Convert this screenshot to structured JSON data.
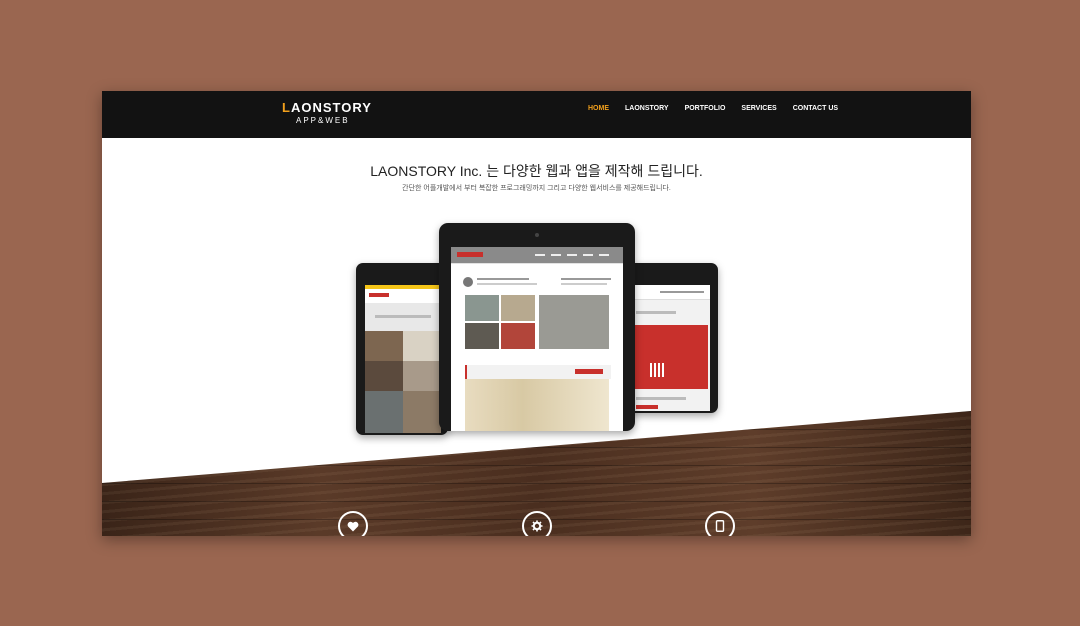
{
  "nav": {
    "logo_main_accent": "L",
    "logo_main_rest": "AONSTORY",
    "logo_sub": "APP&WEB",
    "items": [
      {
        "label": "HOME",
        "active": true
      },
      {
        "label": "LAONSTORY",
        "active": false
      },
      {
        "label": "PORTFOLIO",
        "active": false
      },
      {
        "label": "SERVICES",
        "active": false
      },
      {
        "label": "CONTACT US",
        "active": false
      }
    ]
  },
  "hero": {
    "title": "LAONSTORY Inc. 는 다양한 웹과 앱을 제작해 드립니다.",
    "subtitle": "간단한 어플개발에서 부터 복잡한 프로그래밍까지 그리고 다양한 웹서비스를 제공해드립니다."
  },
  "features": {
    "icons": [
      "heart-icon",
      "gear-icon",
      "mobile-icon"
    ]
  },
  "colors": {
    "accent": "#f2a01c",
    "navbar": "#121212",
    "background": "#9a6650"
  }
}
